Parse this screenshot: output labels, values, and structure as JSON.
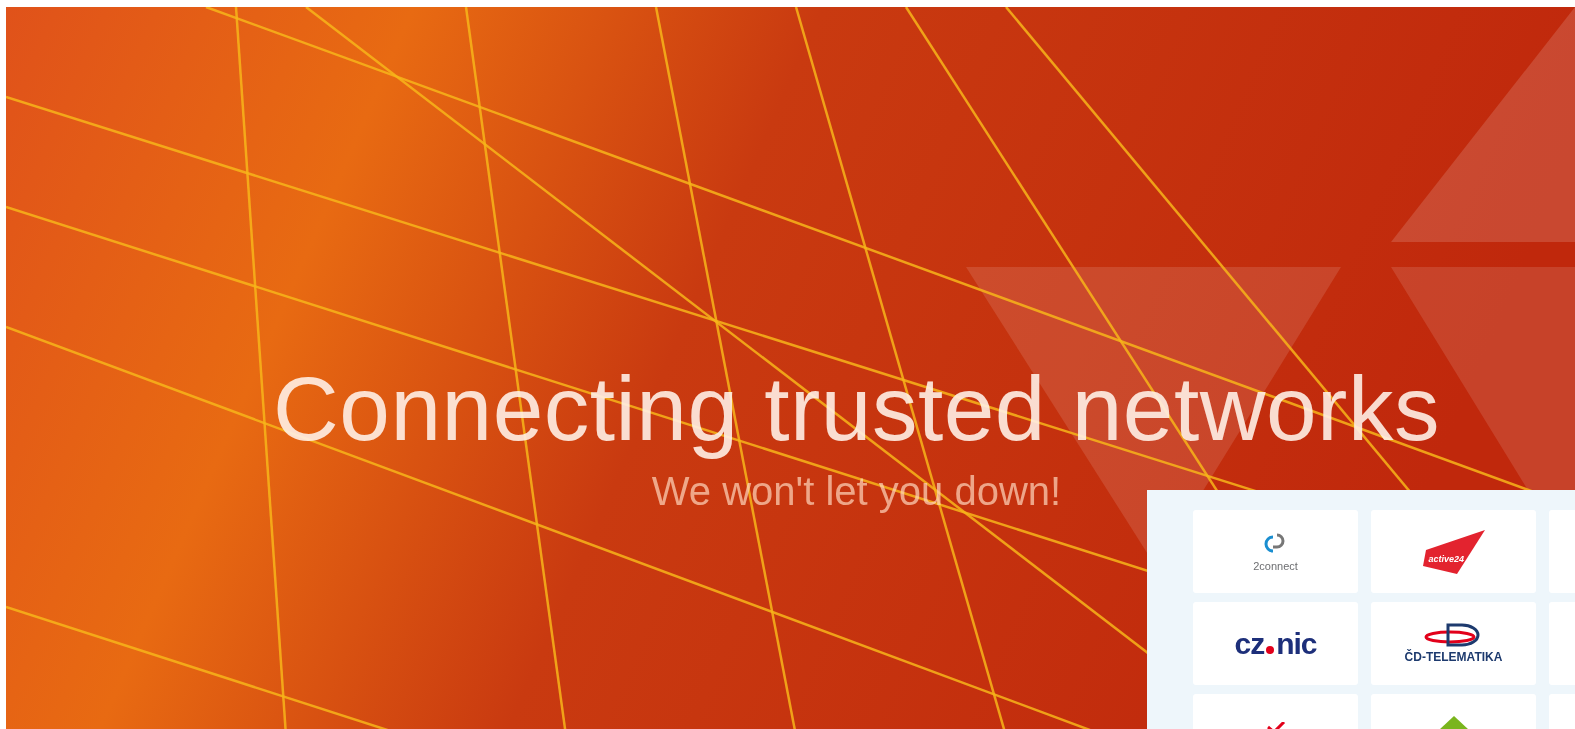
{
  "hero": {
    "title": "Connecting trusted networks",
    "subtitle": "We won't let you down!"
  },
  "members": [
    {
      "kind": "twoconnect",
      "text": "2connect"
    },
    {
      "kind": "active",
      "text": "active24"
    },
    {
      "kind": "blank"
    },
    {
      "kind": "cznic",
      "text": "cz",
      "text2": "nic"
    },
    {
      "kind": "cdt",
      "text": "ČD-TELEMATIKA"
    },
    {
      "kind": "blank"
    },
    {
      "kind": "check"
    },
    {
      "kind": "leaf"
    },
    {
      "kind": "blank"
    }
  ]
}
